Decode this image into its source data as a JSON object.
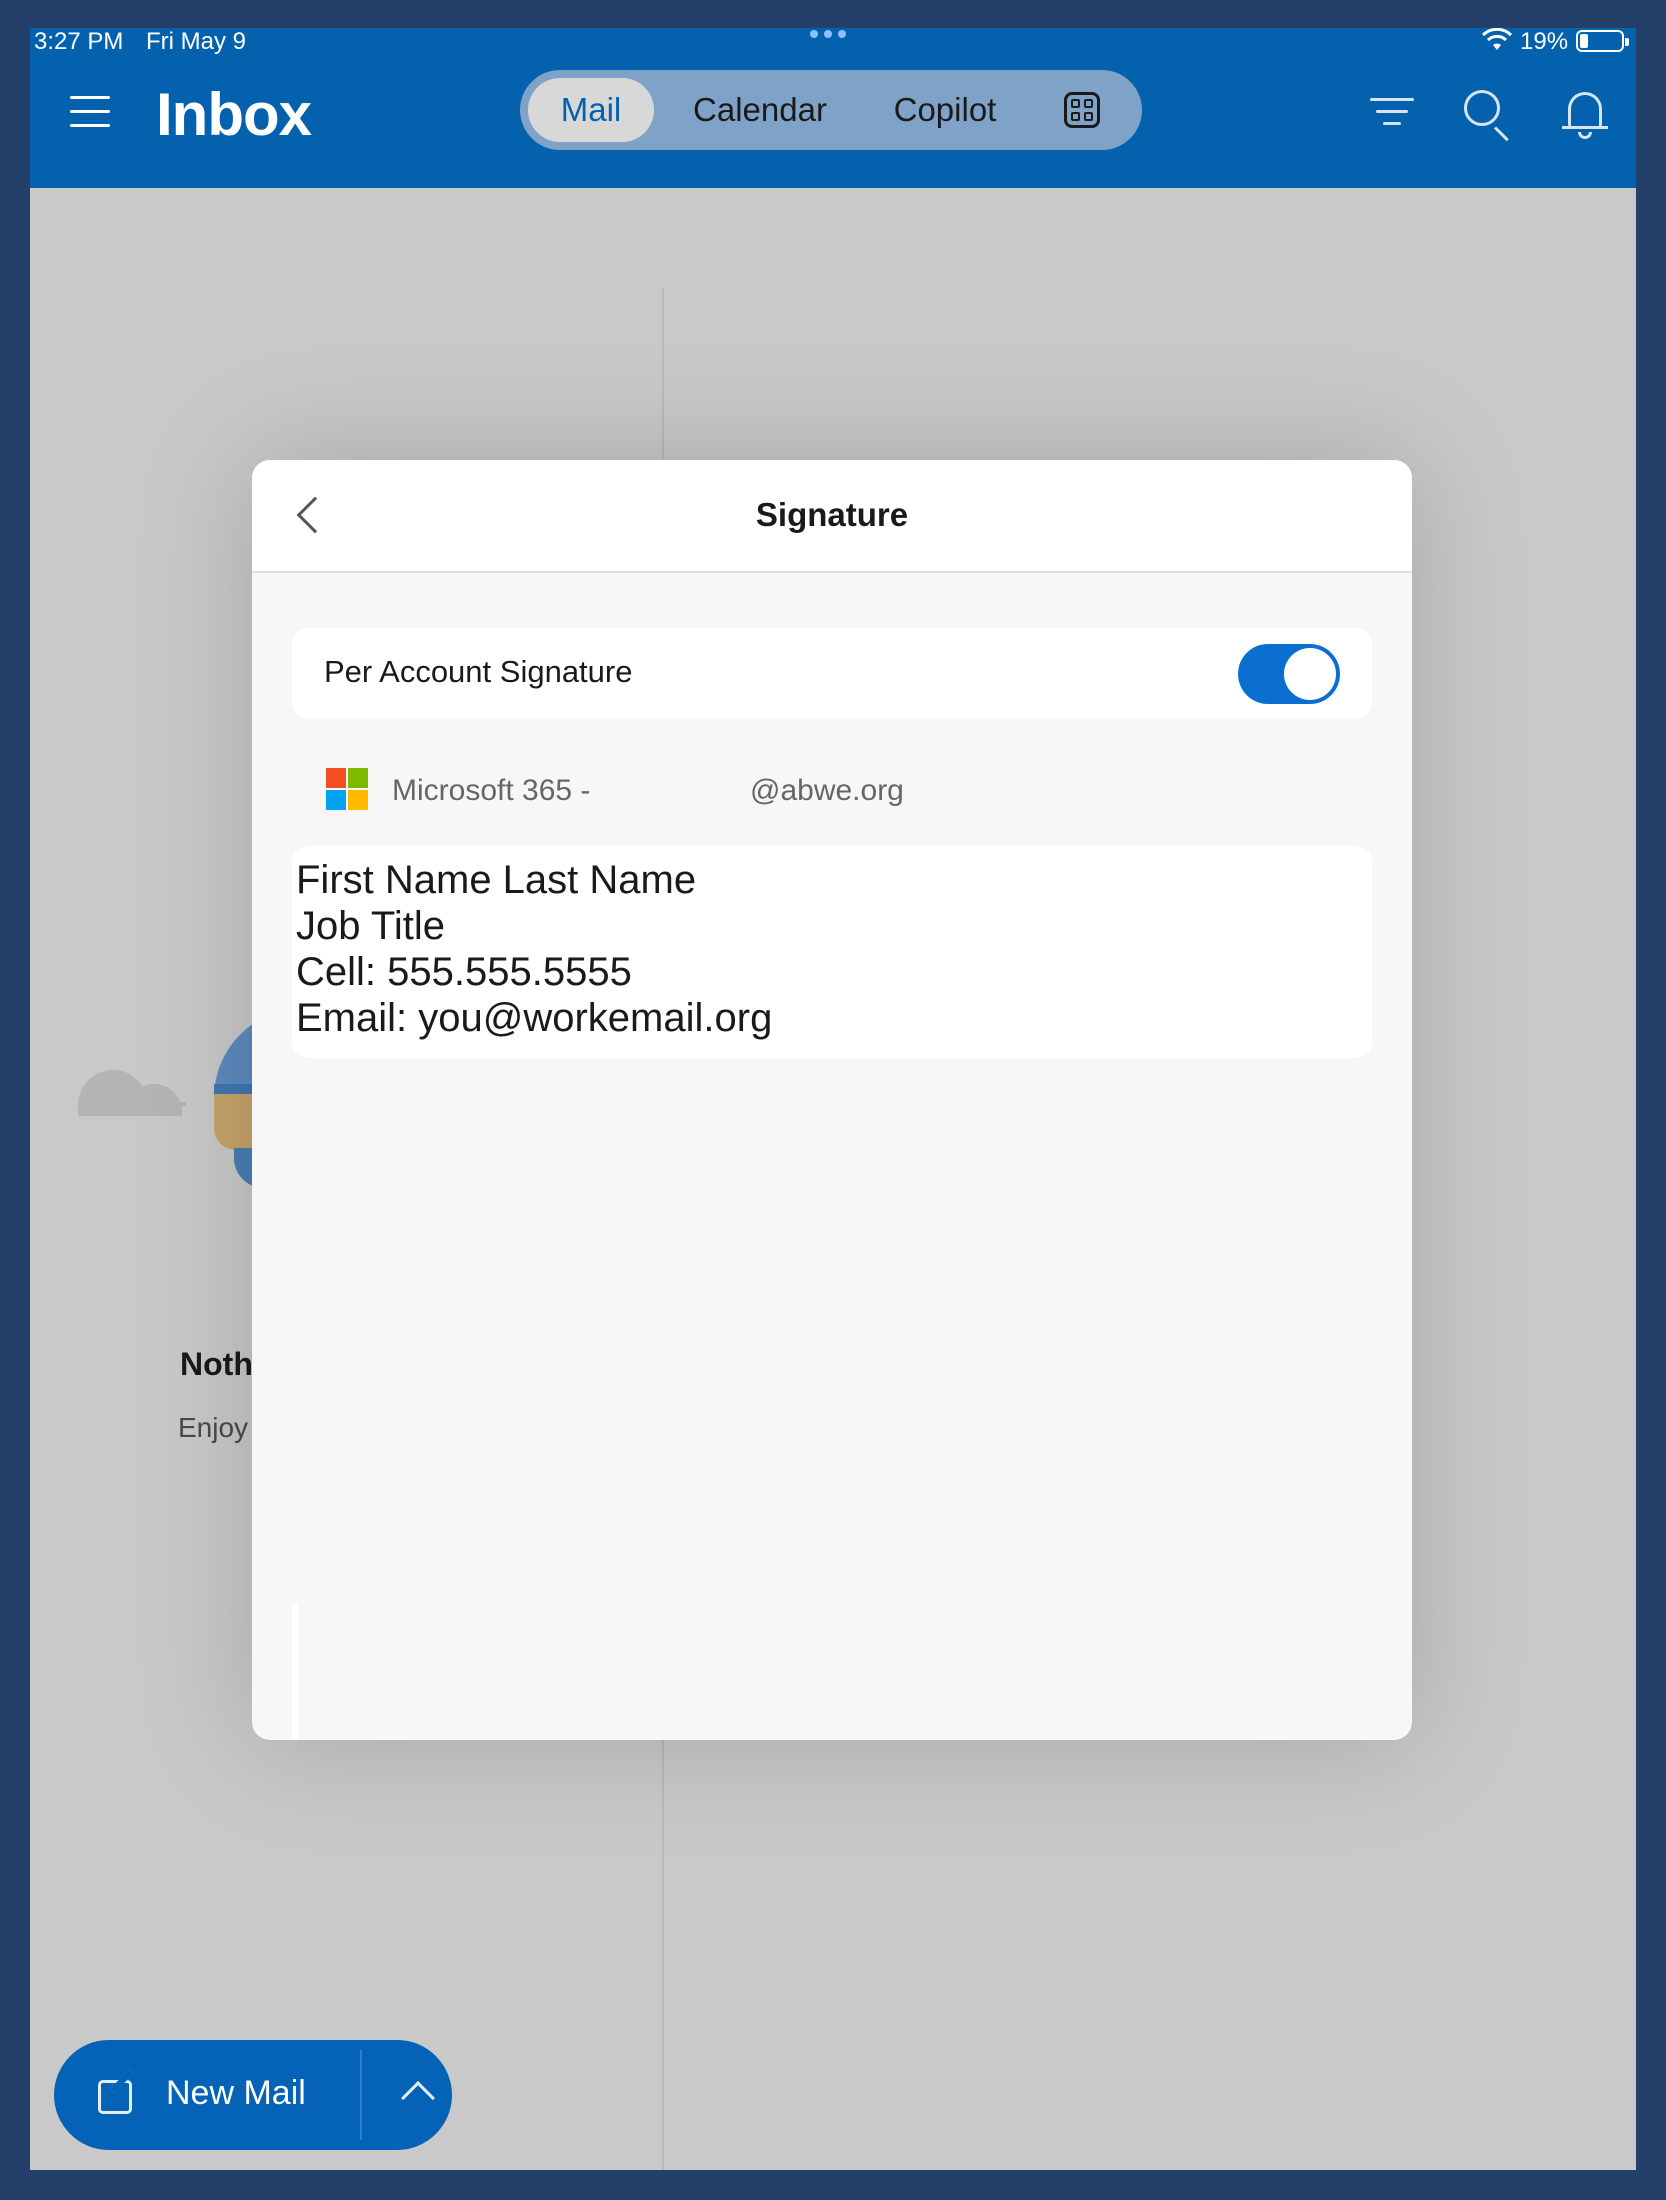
{
  "status_bar": {
    "time": "3:27 PM",
    "date": "Fri May 9",
    "battery_percent": "19%",
    "battery_level": 0.19
  },
  "header": {
    "title": "Inbox",
    "tabs": [
      {
        "label": "Mail",
        "selected": true
      },
      {
        "label": "Calendar",
        "selected": false
      },
      {
        "label": "Copilot",
        "selected": false
      }
    ],
    "icons": [
      "menu-icon",
      "apps-grid-icon",
      "filter-icon",
      "search-icon",
      "bell-icon"
    ]
  },
  "background": {
    "empty_title": "Noth",
    "empty_subtitle": "Enjoy"
  },
  "modal": {
    "title": "Signature",
    "per_account_label": "Per Account Signature",
    "per_account_enabled": true,
    "account_prefix": "Microsoft 365 -",
    "account_domain": "@abwe.org",
    "signature_lines": [
      "First Name Last Name",
      "Job Title",
      "Cell: 555.555.5555",
      "Email: you@workemail.org"
    ]
  },
  "fab": {
    "label": "New Mail"
  },
  "colors": {
    "brand_blue": "#0461ad",
    "toggle_on": "#0a6fd1",
    "ms_red": "#f25022",
    "ms_green": "#7fba00",
    "ms_blue": "#00a4ef",
    "ms_yellow": "#ffb900"
  }
}
